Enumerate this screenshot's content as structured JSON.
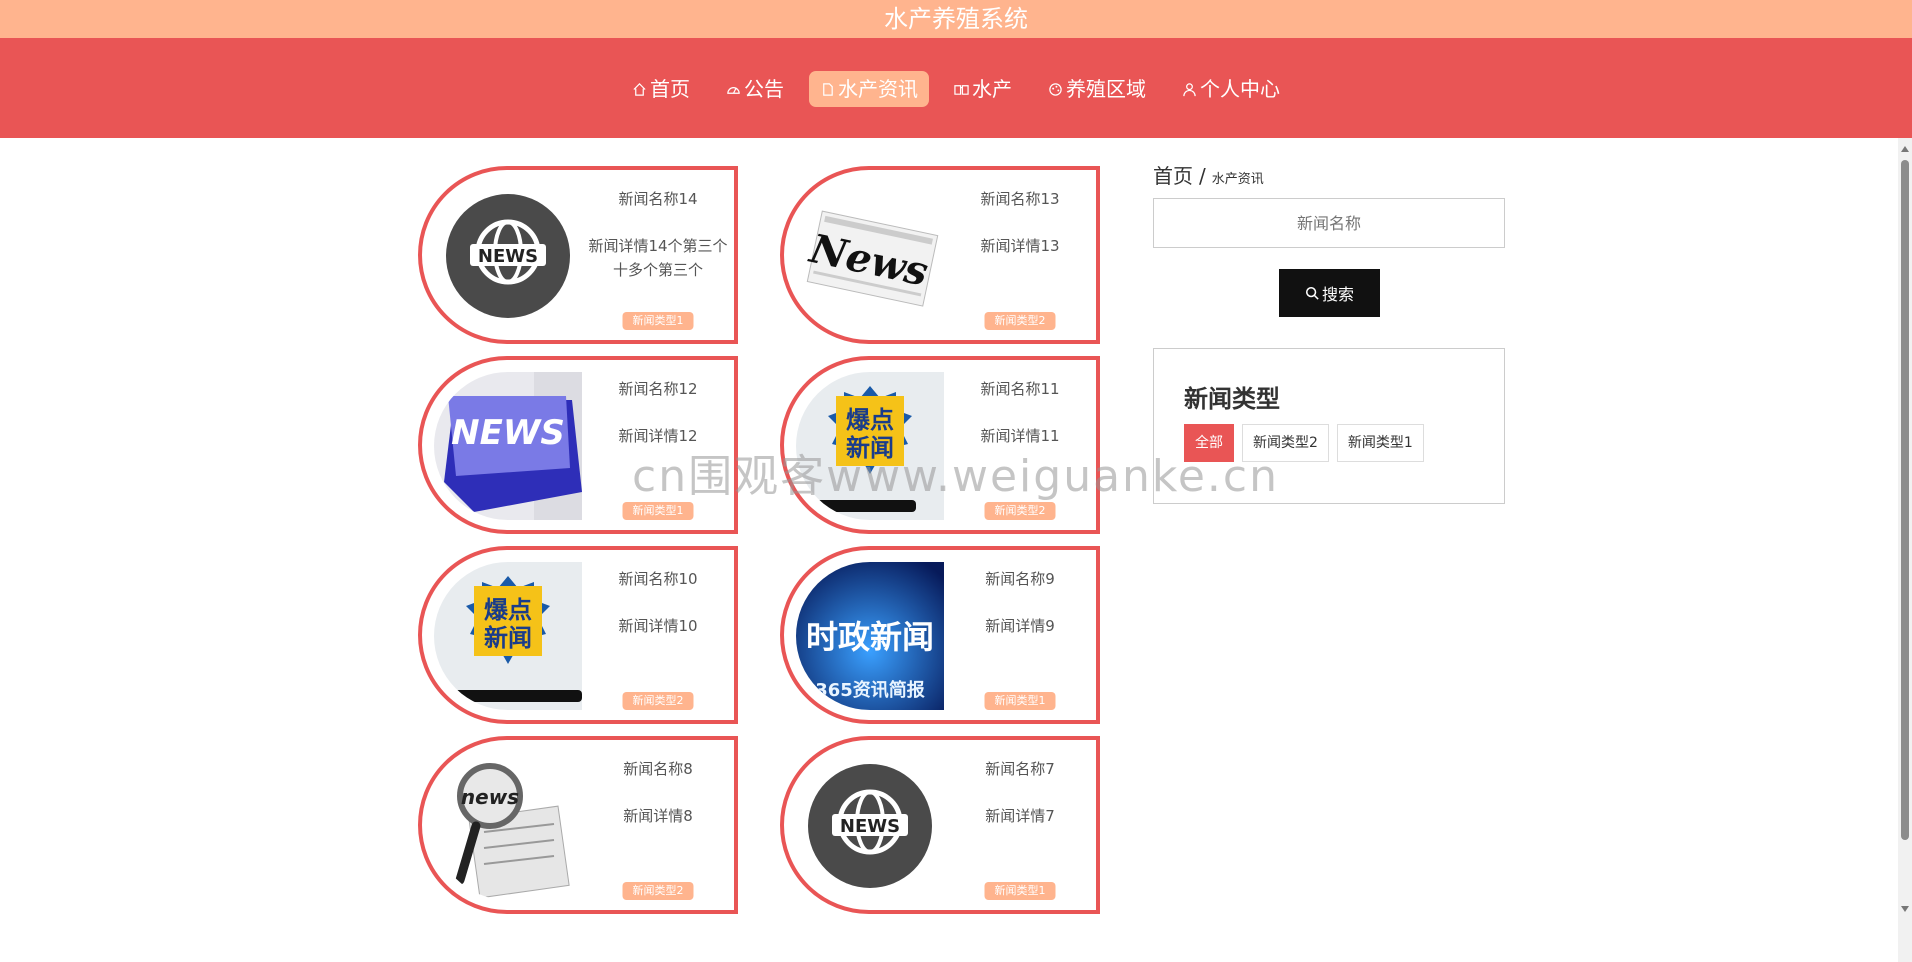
{
  "app": {
    "title": "水产养殖系统"
  },
  "nav": {
    "items": [
      {
        "label": "首页",
        "icon": "home-icon"
      },
      {
        "label": "公告",
        "icon": "gauge-icon"
      },
      {
        "label": "水产资讯",
        "icon": "document-icon",
        "active": true
      },
      {
        "label": "水产",
        "icon": "book-icon"
      },
      {
        "label": "养殖区域",
        "icon": "palette-icon"
      },
      {
        "label": "个人中心",
        "icon": "user-icon"
      }
    ]
  },
  "news": [
    {
      "name": "新闻名称14",
      "detail": "新闻详情14个第三个十多个第三个",
      "type": "新闻类型1",
      "image": "globe-news-icon"
    },
    {
      "name": "新闻名称13",
      "detail": "新闻详情13",
      "type": "新闻类型2",
      "image": "newspaper-news-image"
    },
    {
      "name": "新闻名称12",
      "detail": "新闻详情12",
      "type": "新闻类型1",
      "image": "news-key-image"
    },
    {
      "name": "新闻名称11",
      "detail": "新闻详情11",
      "type": "新闻类型2",
      "image": "breaking-news-phone-image"
    },
    {
      "name": "新闻名称10",
      "detail": "新闻详情10",
      "type": "新闻类型2",
      "image": "breaking-news-phone-image"
    },
    {
      "name": "新闻名称9",
      "detail": "新闻详情9",
      "type": "新闻类型1",
      "image": "politics-news-image"
    },
    {
      "name": "新闻名称8",
      "detail": "新闻详情8",
      "type": "新闻类型2",
      "image": "magnifier-newspaper-image"
    },
    {
      "name": "新闻名称7",
      "detail": "新闻详情7",
      "type": "新闻类型1",
      "image": "globe-news-icon"
    }
  ],
  "images": {
    "globe_text": "NEWS",
    "paper_text": "News",
    "key_text": "NEWS",
    "breaking_line1": "爆点",
    "breaking_line2": "新闻",
    "politics_title": "时政新闻",
    "politics_sub": "365资讯简报",
    "magnifier_text": "news"
  },
  "sidebar": {
    "breadcrumb_home": "首页",
    "breadcrumb_sep": "/",
    "breadcrumb_current": "水产资讯",
    "search_placeholder": "新闻名称",
    "search_button": "搜索",
    "types_title": "新闻类型",
    "types": [
      {
        "label": "全部",
        "active": true
      },
      {
        "label": "新闻类型2"
      },
      {
        "label": "新闻类型1"
      }
    ]
  },
  "watermark": "cn围观客www.weiguanke.cn",
  "colors": {
    "primary": "#e95555",
    "accent": "#ffb48e",
    "dark": "#111111"
  }
}
